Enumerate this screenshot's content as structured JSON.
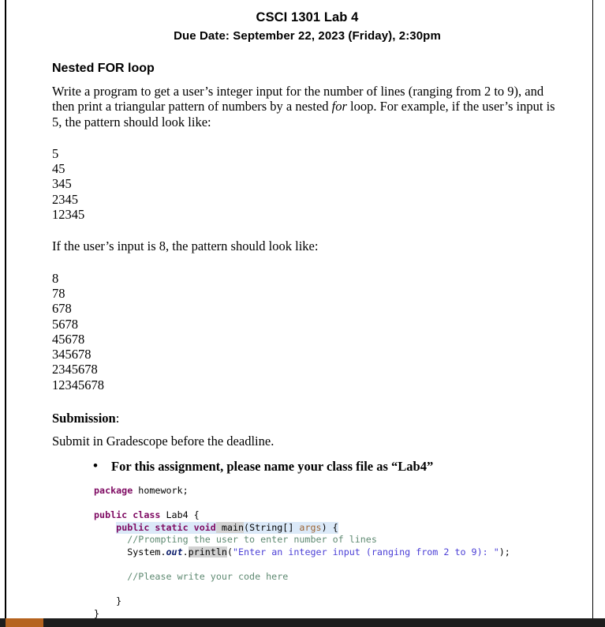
{
  "document": {
    "title": "CSCI 1301 Lab 4",
    "subtitle": "Due Date: September 22, 2023 (Friday), 2:30pm",
    "section_heading": "Nested FOR loop",
    "intro_part1": "Write a program to get a user’s integer input for the number of lines (ranging from 2 to 9), and then print a triangular pattern of numbers by a nested ",
    "intro_italic": "for",
    "intro_part2": " loop. For example, if the user’s input is 5, the pattern should look like:",
    "pattern1": "5\n45\n345\n2345\n12345",
    "second_prompt": "If the user’s input is 8, the pattern should look like:",
    "pattern2": "8\n78\n678\n5678\n45678\n345678\n2345678\n12345678",
    "submission_label": "Submission",
    "submission_colon": ":",
    "submission_text": "Submit in Gradescope before the deadline.",
    "bullets": [
      "For this assignment, please name your class file as “Lab4”"
    ]
  },
  "code": {
    "line1_kw": "package",
    "line1_rest": " homework;",
    "line3_kw1": "public class",
    "line3_rest": " Lab4 {",
    "line4_kw": "public static void",
    "line4_name": " main",
    "line4_open": "(",
    "line4_type": "String[] ",
    "line4_param": "args",
    "line4_close": ") {",
    "line5_comment": "//Prompting the user to enter number of lines",
    "line6_sys": "System.",
    "line6_out": "out",
    "line6_dot": ".",
    "line6_mth": "println",
    "line6_open": "(",
    "line6_str": "\"Enter an integer input (ranging from 2 to 9): \"",
    "line6_end": ");",
    "line8_comment": "//Please write your code here",
    "line10_brace": "}",
    "line11_brace": "}"
  },
  "scrollbar": {
    "orientation": "horizontal",
    "thumb_color": "#b5631f",
    "track_color": "#1d1d1d"
  }
}
